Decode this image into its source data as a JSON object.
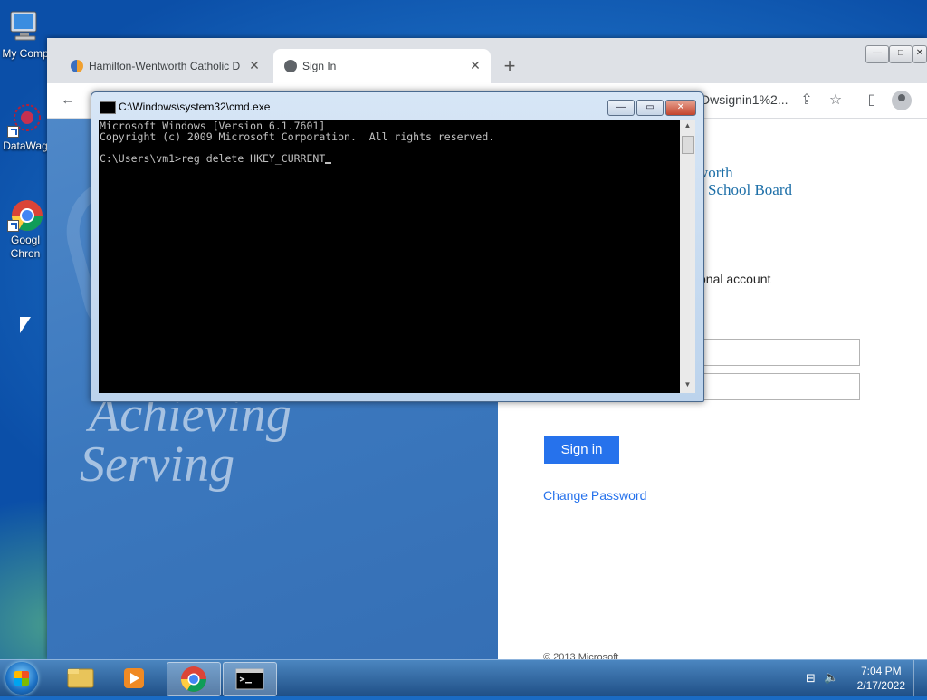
{
  "desktop": {
    "icons": [
      {
        "label": "My Comp",
        "icon": "computer-icon"
      },
      {
        "label": "DataWag",
        "icon": "datawag-icon"
      },
      {
        "label": "Googl\nChron",
        "icon": "chrome-icon"
      }
    ]
  },
  "browser": {
    "tabs": [
      {
        "title": "Hamilton-Wentworth Catholic D",
        "close": "✕",
        "active": false
      },
      {
        "title": "Sign In",
        "close": "✕",
        "active": true
      }
    ],
    "new_tab": "+",
    "url_fragment": "Dwsignin1%2...",
    "window_controls": [
      "—",
      "□",
      "✕"
    ]
  },
  "page": {
    "hero_words": [
      "Achieving",
      "Serving"
    ],
    "org_line1": "worth",
    "org_line2": "School Board",
    "account_text": "onal account",
    "signin_label": "Sign in",
    "change_password": "Change Password",
    "copyright": "© 2013 Microsoft"
  },
  "cmd": {
    "title": "C:\\Windows\\system32\\cmd.exe",
    "lines": [
      "Microsoft Windows [Version 6.1.7601]",
      "Copyright (c) 2009 Microsoft Corporation.  All rights reserved.",
      "",
      "C:\\Users\\vm1>reg delete HKEY_CURRENT"
    ]
  },
  "taskbar": {
    "time": "7:04 PM",
    "date": "2/17/2022"
  },
  "colors": {
    "accent": "#2672ec",
    "org_text": "#1d6fa8"
  }
}
